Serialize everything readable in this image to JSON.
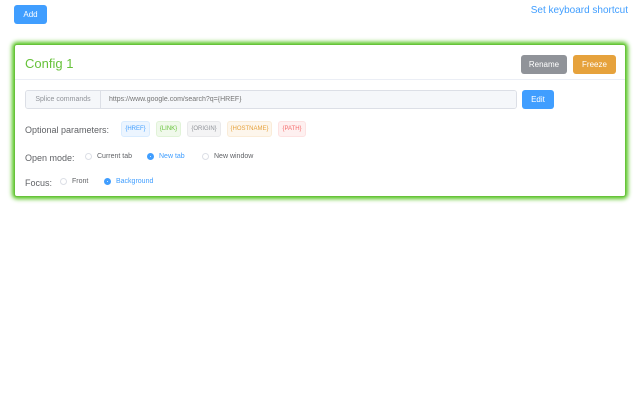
{
  "toolbar": {
    "add_label": "Add",
    "shortcut_label": "Set keyboard shortcut"
  },
  "config": {
    "title": "Config 1",
    "rename_label": "Rename",
    "freeze_label": "Freeze",
    "splice": {
      "label": "Splice commands",
      "placeholder": "https://www.google.com/search?q={HREF}",
      "edit_label": "Edit"
    },
    "params": {
      "label": "Optional parameters:",
      "tags": [
        "{HREF}",
        "{LINK}",
        "{ORIGIN}",
        "{HOSTNAME}",
        "{PATH}"
      ]
    },
    "open_mode": {
      "label": "Open mode:",
      "options": [
        "Current tab",
        "New tab",
        "New window"
      ],
      "selected": "New tab"
    },
    "focus": {
      "label": "Focus:",
      "options": [
        "Front",
        "Background"
      ],
      "selected": "Background"
    }
  },
  "colors": {
    "primary": "#409eff",
    "success": "#67c23a",
    "warning": "#e6a23c",
    "info": "#909399",
    "danger": "#f56c6c"
  }
}
